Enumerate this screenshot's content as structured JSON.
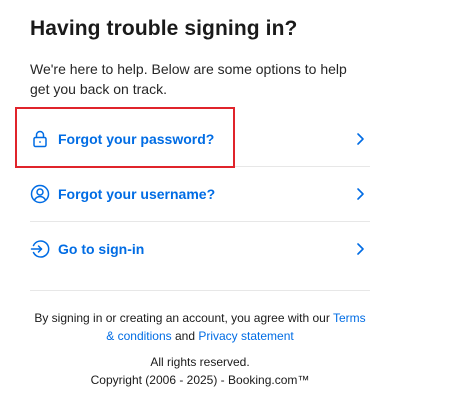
{
  "page": {
    "title": "Having trouble signing in?",
    "intro": "We're here to help. Below are some options to help get you back on track."
  },
  "options": [
    {
      "label": "Forgot your password?",
      "icon": "lock-icon"
    },
    {
      "label": "Forgot your username?",
      "icon": "user-circle-icon"
    },
    {
      "label": "Go to sign-in",
      "icon": "sign-in-icon"
    }
  ],
  "legal": {
    "prefix": "By signing in or creating an account, you agree with our ",
    "terms_link": "Terms & conditions",
    "middle": " and ",
    "privacy_link": "Privacy statement"
  },
  "footer": {
    "rights": "All rights reserved.",
    "copyright": "Copyright (2006 - 2025) - Booking.com™"
  },
  "colors": {
    "accent": "#006ce4",
    "highlight": "#e0242b",
    "divider": "#e7e7e7",
    "text": "#1a1a1a"
  }
}
